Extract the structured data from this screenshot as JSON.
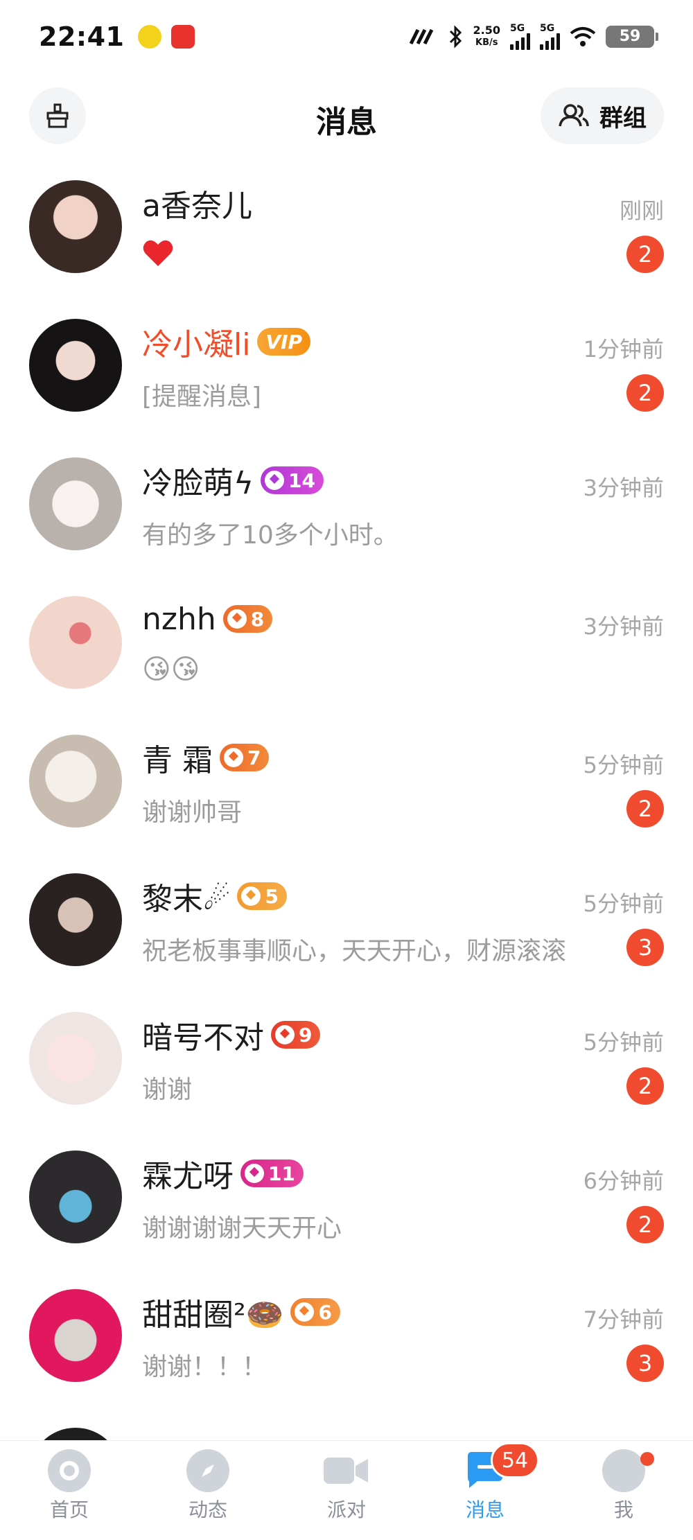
{
  "status_bar": {
    "time": "22:41",
    "net_speed": "2.50",
    "net_unit": "KB/s",
    "sim1": "5G",
    "sim2": "5G",
    "battery": "59"
  },
  "header": {
    "title": "消息",
    "group_label": "群组",
    "left_icon": "clean-broom-icon",
    "group_icon": "group-users-icon"
  },
  "conversations": [
    {
      "name": "a香奈儿",
      "time": "刚刚",
      "preview": "❤️",
      "unread": "2"
    },
    {
      "name": "冷小凝li",
      "vip": "VIP",
      "time": "1分钟前",
      "preview": "[提醒消息]",
      "unread": "2"
    },
    {
      "name": "冷脸萌ϟ",
      "level": "14",
      "time": "3分钟前",
      "preview": "有的多了10多个小时。"
    },
    {
      "name": "nzhh",
      "level": "8",
      "time": "3分钟前",
      "preview": "😘😘"
    },
    {
      "name": "青 霜",
      "level": "7",
      "time": "5分钟前",
      "preview": "谢谢帅哥",
      "unread": "2"
    },
    {
      "name": "黎末☄",
      "level": "5",
      "time": "5分钟前",
      "preview": "祝老板事事顺心，天天开心，财源滚滚",
      "unread": "3"
    },
    {
      "name": "暗号不对",
      "level": "9",
      "time": "5分钟前",
      "preview": "谢谢",
      "unread": "2"
    },
    {
      "name": "霖尤呀",
      "level": "11",
      "time": "6分钟前",
      "preview": "谢谢谢谢天天开心",
      "unread": "2"
    },
    {
      "name": "甜甜圈²🍩",
      "level": "6",
      "time": "7分钟前",
      "preview": "谢谢！！！",
      "unread": "3"
    }
  ],
  "bottom_nav": {
    "items": [
      {
        "label": "首页",
        "icon": "home-icon"
      },
      {
        "label": "动态",
        "icon": "compass-icon"
      },
      {
        "label": "派对",
        "icon": "video-camera-icon"
      },
      {
        "label": "消息",
        "icon": "message-icon",
        "badge": "54"
      },
      {
        "label": "我",
        "icon": "profile-icon"
      }
    ]
  },
  "colors": {
    "accent": "#2b9af3",
    "unread": "#f04b2e",
    "vip_name": "#f04e2b"
  }
}
